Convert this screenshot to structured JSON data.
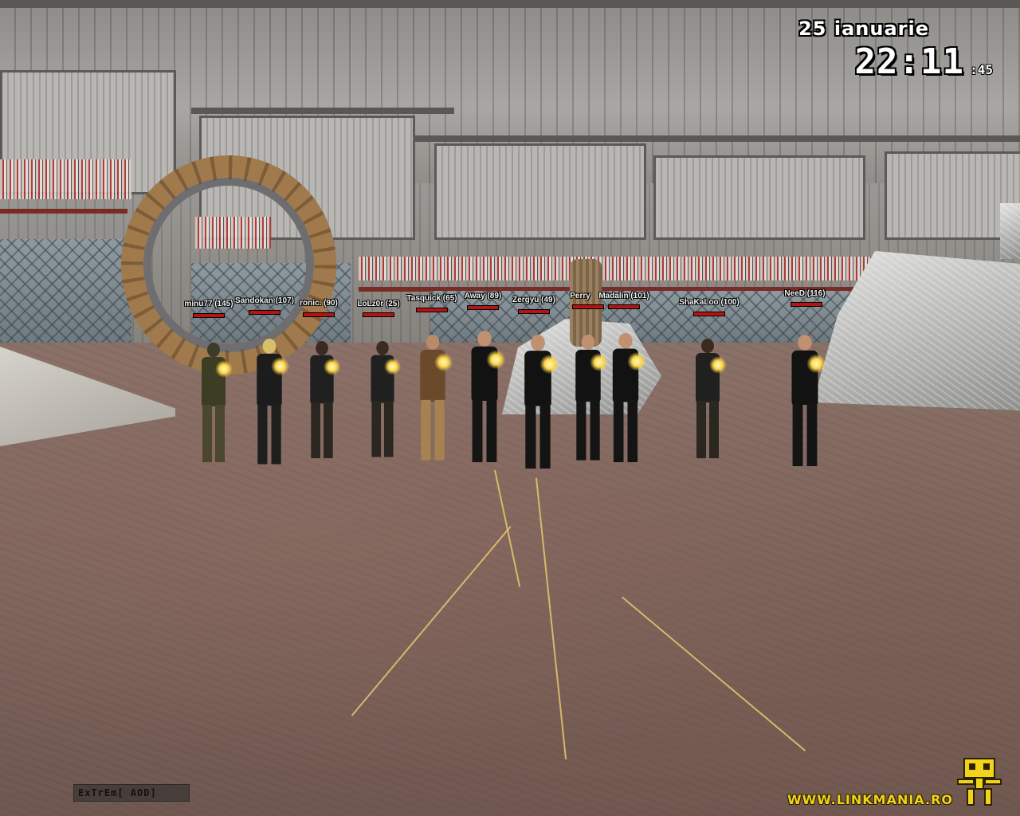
{
  "hud": {
    "date": "25 ianuarie",
    "time": "22:11",
    "seconds": ":45"
  },
  "chat_box": {
    "text": "ExTrEm[ AOD]"
  },
  "watermark": {
    "text": "WWW.LINKMANIA.RO",
    "icon": "robot-mascot-icon",
    "color": "#f2d21a"
  },
  "players": [
    {
      "tag": "minu77 (145)",
      "skin": "female-hood"
    },
    {
      "tag": "Sandokan (107)",
      "skin": "female-blonde"
    },
    {
      "tag": "ronic. (90)",
      "skin": "female-black"
    },
    {
      "tag": "LoLz0r (25)",
      "skin": "female-black"
    },
    {
      "tag": "Tasquick (65)",
      "skin": "male-brown-jacket"
    },
    {
      "tag": "Away (89)",
      "skin": "male-black-suit"
    },
    {
      "tag": "Zergyu (49)",
      "skin": "male-black-suit"
    },
    {
      "tag": "Perry",
      "skin": "male-black-suit"
    },
    {
      "tag": "Madalin (101)",
      "skin": "male-black-suit"
    },
    {
      "tag": "ShaKaLoo (100)",
      "skin": "female-black"
    },
    {
      "tag": "NeeD (116)",
      "skin": "male-black-suit"
    }
  ],
  "colors": {
    "health_bar": "#b41414",
    "hud_text": "#ffffff"
  }
}
